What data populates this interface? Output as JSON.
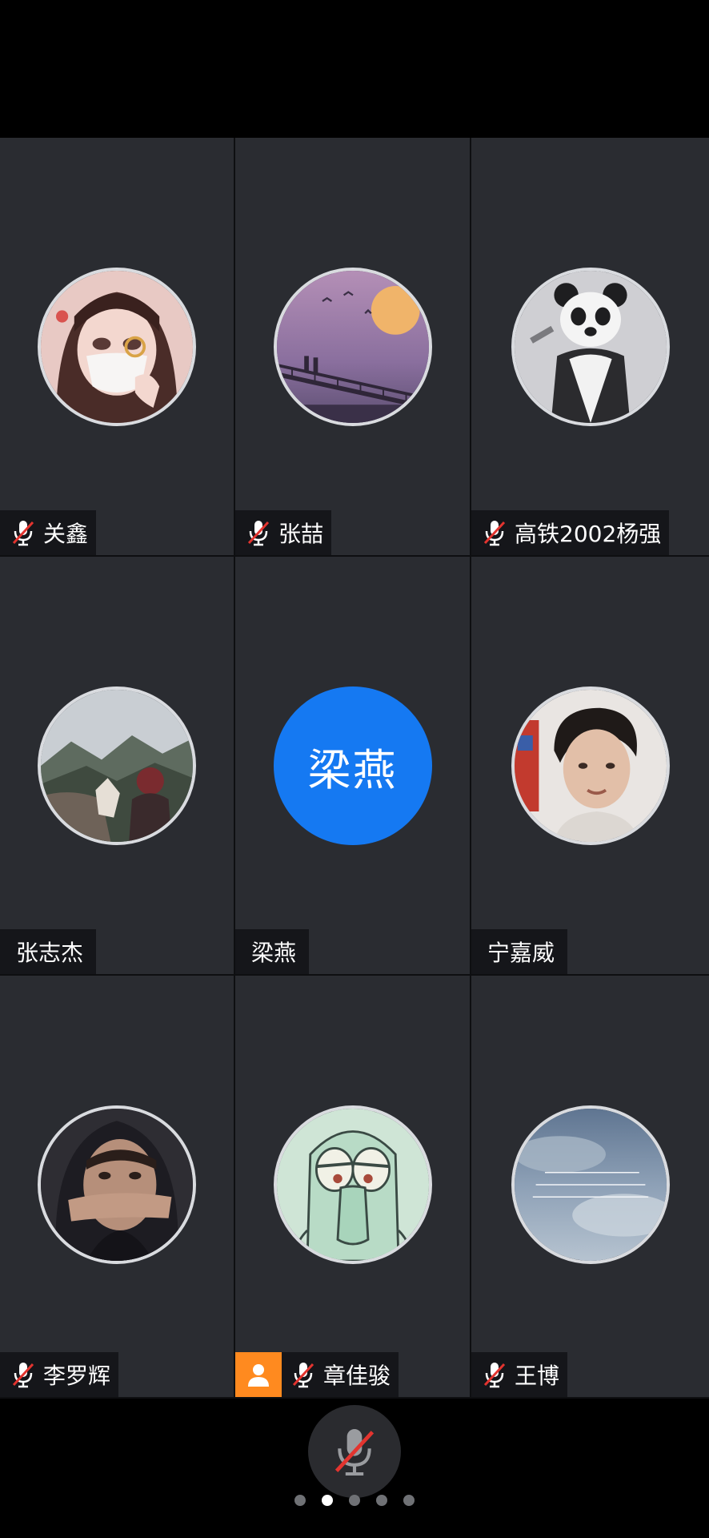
{
  "participants": [
    {
      "name": "关鑫",
      "muted": true,
      "avatar": "girl-mask-avatar"
    },
    {
      "name": "张喆",
      "muted": true,
      "avatar": "sunset-bridge-avatar"
    },
    {
      "name": "高铁2002杨强",
      "muted": true,
      "avatar": "panda-avatar"
    },
    {
      "name": "张志杰",
      "muted": false,
      "avatar": "mountain-hikers-avatar"
    },
    {
      "name": "梁燕",
      "muted": false,
      "avatar_text": "梁燕"
    },
    {
      "name": "宁嘉威",
      "muted": false,
      "avatar": "man-portrait-avatar"
    },
    {
      "name": "李罗辉",
      "muted": true,
      "avatar": "hooded-man-avatar"
    },
    {
      "name": "章佳骏",
      "muted": true,
      "host": true,
      "avatar": "squidward-avatar"
    },
    {
      "name": "王博",
      "muted": true,
      "avatar": "sky-text-avatar"
    }
  ],
  "pagination": {
    "pages": 5,
    "current": 2
  },
  "colors": {
    "tile_bg": "#2a2c31",
    "text_avatar_bg": "#1579f2",
    "host_badge": "#ff8a1f",
    "mute_red": "#e3342f"
  }
}
